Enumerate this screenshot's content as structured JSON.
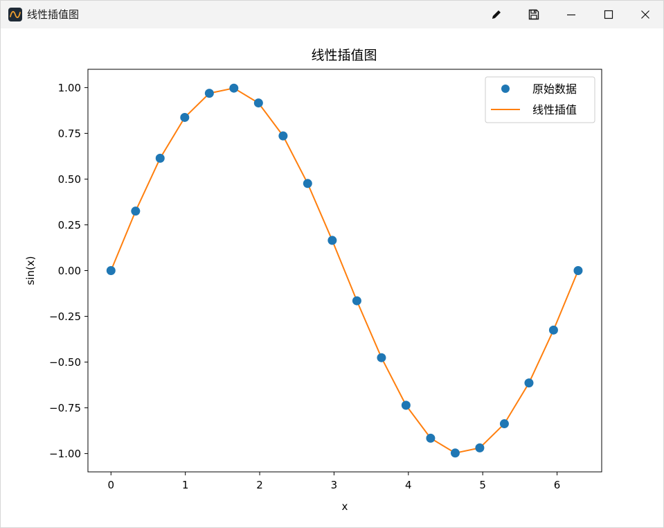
{
  "window": {
    "title": "线性插值图",
    "icons": {
      "app": "plot-app-icon",
      "edit": "pencil-icon",
      "save": "floppy-disk-icon",
      "minimize": "minimize-icon",
      "maximize": "maximize-icon",
      "close": "close-icon"
    }
  },
  "chart_data": {
    "type": "line",
    "title": "线性插值图",
    "xlabel": "x",
    "ylabel": "sin(x)",
    "xlim": [
      -0.31,
      6.6
    ],
    "ylim": [
      -1.1,
      1.1
    ],
    "xticks": [
      0,
      1,
      2,
      3,
      4,
      5,
      6
    ],
    "xtick_labels": [
      "0",
      "1",
      "2",
      "3",
      "4",
      "5",
      "6"
    ],
    "yticks": [
      1.0,
      0.75,
      0.5,
      0.25,
      0.0,
      -0.25,
      -0.5,
      -0.75,
      -1.0
    ],
    "ytick_labels": [
      "1.00",
      "0.75",
      "0.50",
      "0.25",
      "0.00",
      "−0.25",
      "−0.50",
      "−0.75",
      "−1.00"
    ],
    "grid": false,
    "legend_position": "top-right",
    "series": [
      {
        "name": "原始数据",
        "kind": "scatter",
        "color": "#1f77b4",
        "x": [
          0.0,
          0.331,
          0.661,
          0.992,
          1.323,
          1.653,
          1.984,
          2.315,
          2.645,
          2.976,
          3.307,
          3.638,
          3.968,
          4.299,
          4.63,
          4.96,
          5.291,
          5.622,
          5.952,
          6.283
        ],
        "y": [
          0.0,
          0.325,
          0.614,
          0.837,
          0.969,
          0.997,
          0.916,
          0.736,
          0.476,
          0.165,
          -0.165,
          -0.476,
          -0.736,
          -0.916,
          -0.997,
          -0.969,
          -0.837,
          -0.614,
          -0.325,
          -0.0
        ]
      },
      {
        "name": "线性插值",
        "kind": "line",
        "color": "#ff7f0e",
        "x": [
          0.0,
          0.331,
          0.661,
          0.992,
          1.323,
          1.653,
          1.984,
          2.315,
          2.645,
          2.976,
          3.307,
          3.638,
          3.968,
          4.299,
          4.63,
          4.96,
          5.291,
          5.622,
          5.952,
          6.283
        ],
        "y": [
          0.0,
          0.325,
          0.614,
          0.837,
          0.969,
          0.997,
          0.916,
          0.736,
          0.476,
          0.165,
          -0.165,
          -0.476,
          -0.736,
          -0.916,
          -0.997,
          -0.969,
          -0.837,
          -0.614,
          -0.325,
          -0.0
        ]
      }
    ]
  }
}
